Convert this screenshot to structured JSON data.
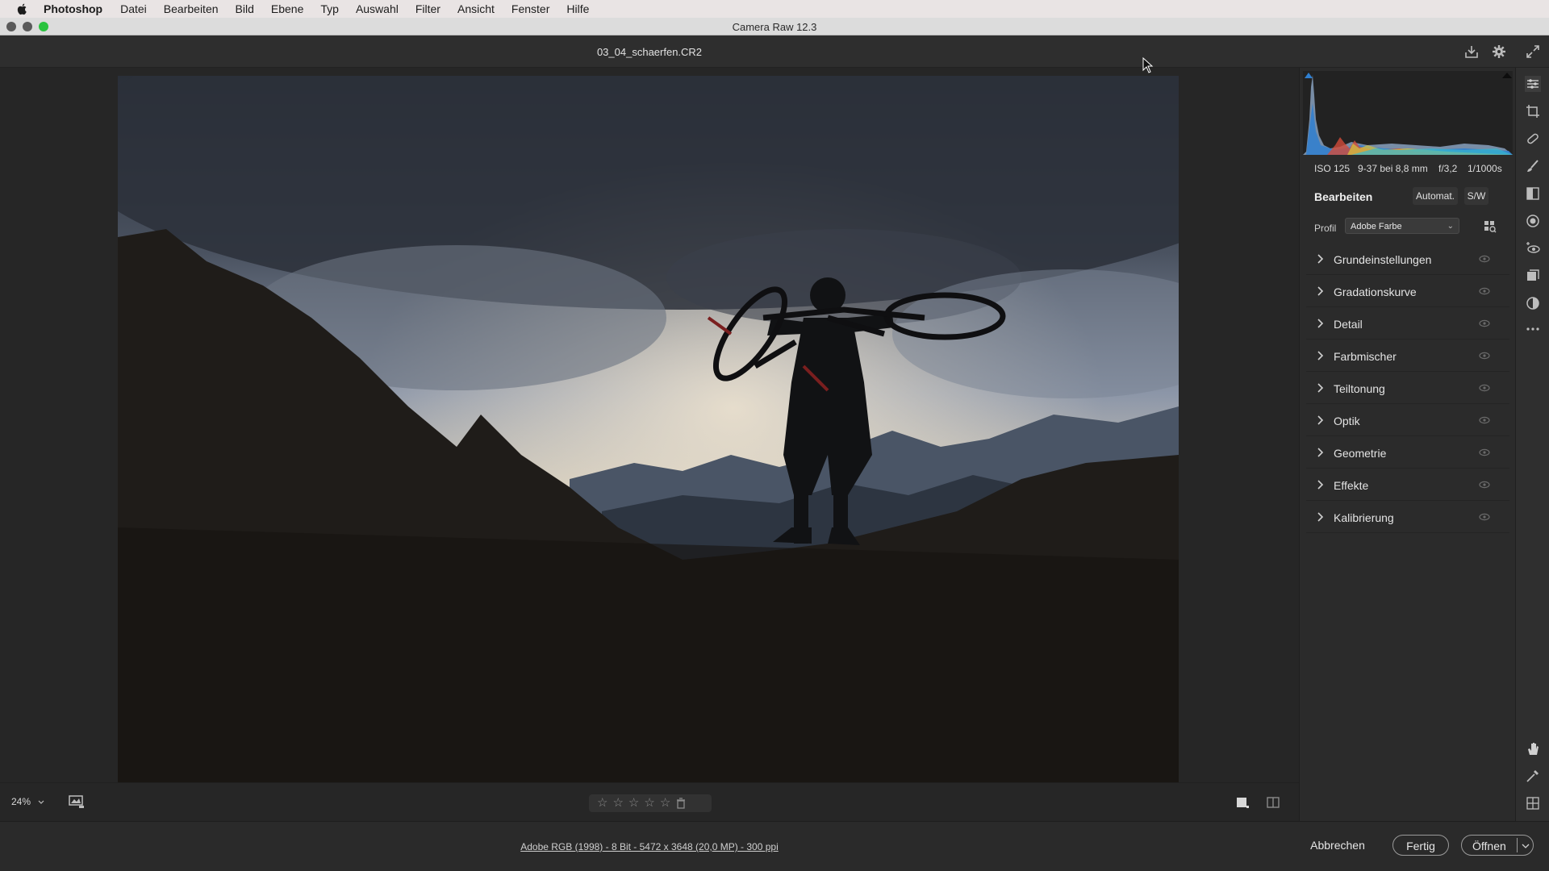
{
  "menubar": {
    "app": "Photoshop",
    "items": [
      "Datei",
      "Bearbeiten",
      "Bild",
      "Ebene",
      "Typ",
      "Auswahl",
      "Filter",
      "Ansicht",
      "Fenster",
      "Hilfe"
    ]
  },
  "window": {
    "title": "Camera Raw 12.3"
  },
  "file": {
    "name": "03_04_schaerfen.CR2"
  },
  "exif": {
    "iso": "ISO 125",
    "lens": "9-37 bei 8,8 mm",
    "aperture": "f/3,2",
    "shutter": "1/1000s"
  },
  "panel": {
    "heading": "Bearbeiten",
    "auto_label": "Automat.",
    "bw_label": "S/W",
    "profile_label": "Profil",
    "profile_value": "Adobe Farbe",
    "sections": [
      "Grundeinstellungen",
      "Gradationskurve",
      "Detail",
      "Farbmischer",
      "Teiltonung",
      "Optik",
      "Geometrie",
      "Effekte",
      "Kalibrierung"
    ]
  },
  "bottombar": {
    "zoom": "24%",
    "rating_stars": 0,
    "rating_max": 5
  },
  "footer": {
    "info": "Adobe RGB (1998) - 8 Bit - 5472 x 3648 (20,0 MP) - 300 ppi",
    "cancel": "Abbrechen",
    "done": "Fertig",
    "open": "Öffnen"
  },
  "colors": {
    "accent_traffic_close": "#4b4b4b",
    "traffic_zoom": "#2ac33f"
  },
  "icons": {
    "header": [
      "save-icon",
      "settings-gear-icon",
      "fullscreen-icon"
    ],
    "toolstrip": [
      "edit-sliders-icon",
      "crop-icon",
      "healing-icon",
      "brush-icon",
      "graduated-filter-icon",
      "radial-filter-icon",
      "red-eye-icon",
      "snapshots-icon",
      "presets-icon",
      "more-icon",
      "hand-icon",
      "color-sampler-icon",
      "grid-icon"
    ]
  }
}
